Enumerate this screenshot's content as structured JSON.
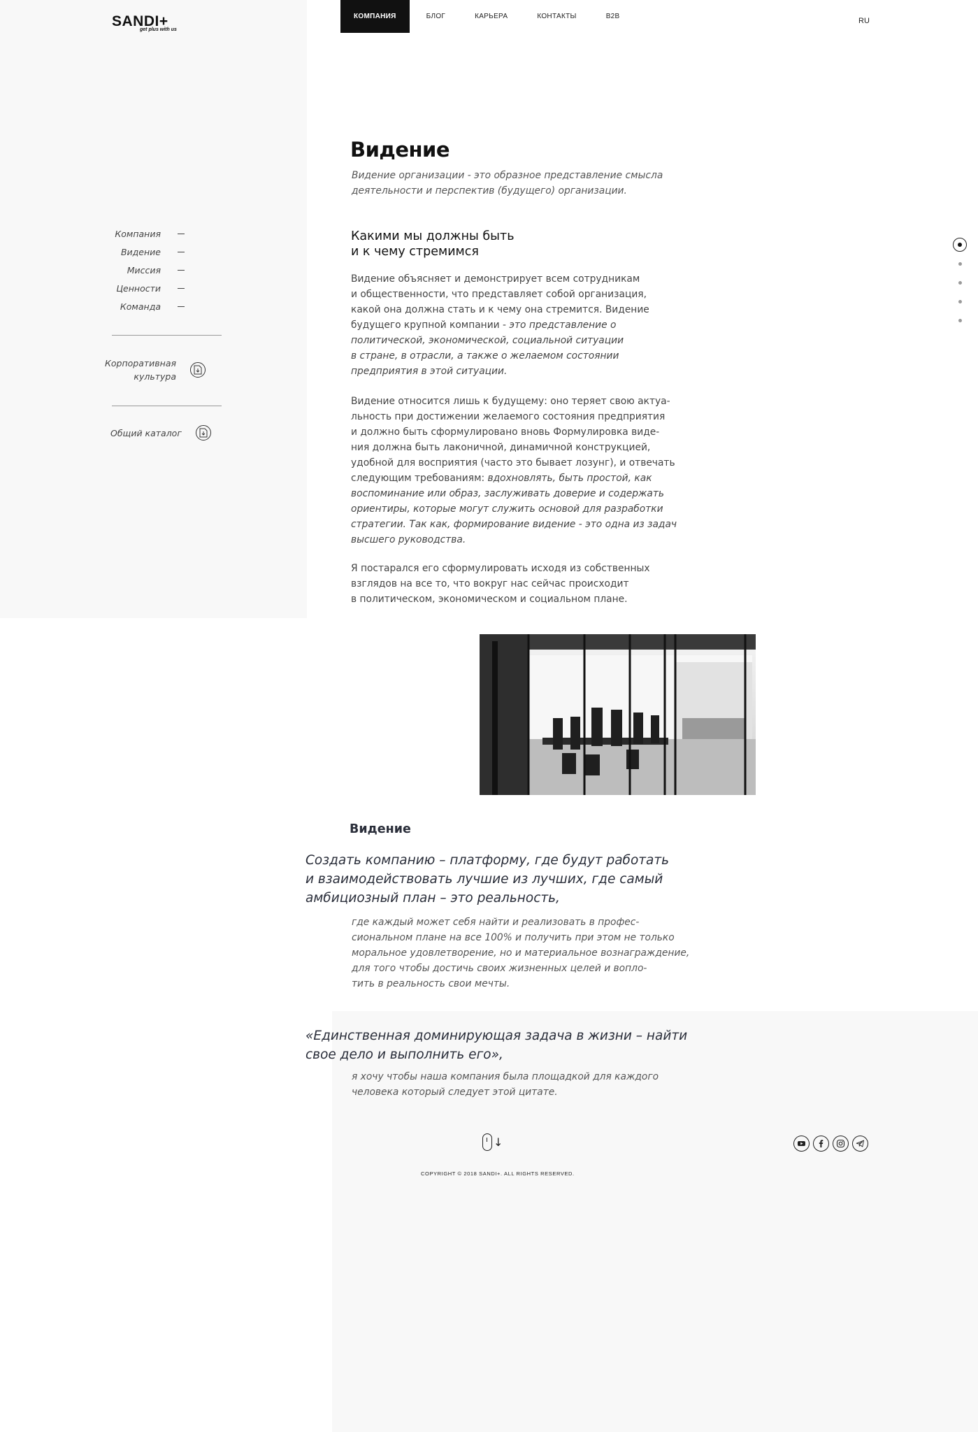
{
  "header": {
    "logo_text": "SANDI+",
    "logo_tagline": "get plus with us",
    "nav": [
      {
        "label": "КОМПАНИЯ",
        "active": true
      },
      {
        "label": "БЛОГ",
        "active": false
      },
      {
        "label": "КАРЬЕРА",
        "active": false
      },
      {
        "label": "КОНТАКТЫ",
        "active": false
      },
      {
        "label": "B2B",
        "active": false
      }
    ],
    "lang": "RU"
  },
  "sidebar": {
    "items": [
      {
        "label": "Компания"
      },
      {
        "label": "Видение"
      },
      {
        "label": "Миссия"
      },
      {
        "label": "Ценности"
      },
      {
        "label": "Команда"
      }
    ],
    "docs": [
      {
        "label_line1": "Корпоративная",
        "label_line2": "культура",
        "icon": "document-icon"
      },
      {
        "label_line1": "Общий каталог",
        "label_line2": "",
        "icon": "document-icon"
      }
    ]
  },
  "main": {
    "title": "Видение",
    "subtitle_line1": "Видение организации - это образное представление смысла",
    "subtitle_line2": "деятельности и перспектив (будущего) организации.",
    "heading_line1": "Какими мы должны быть",
    "heading_line2": "и к чему стремимся",
    "p1": {
      "l1": "Видение объясняет и демонстрирует всем сотрудникам",
      "l2": "и общественности, что представляет собой организация,",
      "l3": "какой она должна стать и к чему она стремится. Видение",
      "l4a": "будущего крупной компании - ",
      "l4b": "это представление о",
      "l5": "политической, экономической, социальной ситуации",
      "l6": "в стране, в отрасли, а также о желаемом состоянии",
      "l7": "предприятия в этой ситуации."
    },
    "p2": {
      "l1": "Видение относится лишь к будущему: оно теряет свою актуа-",
      "l2": "льность при достижении желаемого состояния предприятия",
      "l3": "и должно быть сформулировано вновь Формулировка виде-",
      "l4": "ния должна быть лаконичной, динамичной конструкцией,",
      "l5": "удобной для восприятия (часто это бывает лозунг), и отвечать",
      "l6a": "следующим требованиям: ",
      "l6b": "вдохновлять, быть простой, как",
      "l7": "воспоминание или образ, заслуживать доверие и содержать",
      "l8": "ориентиры, которые могут служить основой для разработки",
      "l9": "стратегии. Так как, формирование видение - это одна из задач",
      "l10": "высшего руководства."
    },
    "p3": {
      "l1": "Я постарался его сформулировать исходя из собственных",
      "l2": "взглядов на все то, что вокруг нас сейчас происходит",
      "l3": "в политическом, экономическом и социальном плане."
    }
  },
  "vision": {
    "label": "Видение",
    "quote1_l1": "Создать компанию – платформу, где будут работать",
    "quote1_l2": "и взаимодействовать лучшие из лучших, где самый",
    "quote1_l3": "амбициозный план – это реальность,",
    "sub1_l1": "где каждый может себя найти и реализовать в профес-",
    "sub1_l2": "сиональном плане на все 100% и получить при этом не только",
    "sub1_l3": "моральное удовлетворение, но и материальное вознаграждение,",
    "sub1_l4": "для того чтобы достичь своих жизненных целей и вопло-",
    "sub1_l5": "тить в реальность свои мечты.",
    "quote2_l1": "«Единственная доминирующая задача в жизни – найти",
    "quote2_l2": "свое дело и выполнить его»,",
    "sub2_l1": "я хочу чтобы наша компания была площадкой для каждого",
    "sub2_l2": "человека который следует этой цитате."
  },
  "footer": {
    "copyright": "COPYRIGHT © 2018 SANDI+. ALL RIGHTS RESERVED.",
    "social_icons": [
      "youtube-icon",
      "facebook-icon",
      "instagram-icon",
      "telegram-icon"
    ],
    "scroll_icon": "mouse-scroll-icon"
  },
  "section_dots": {
    "count": 5,
    "active_index": 0
  }
}
